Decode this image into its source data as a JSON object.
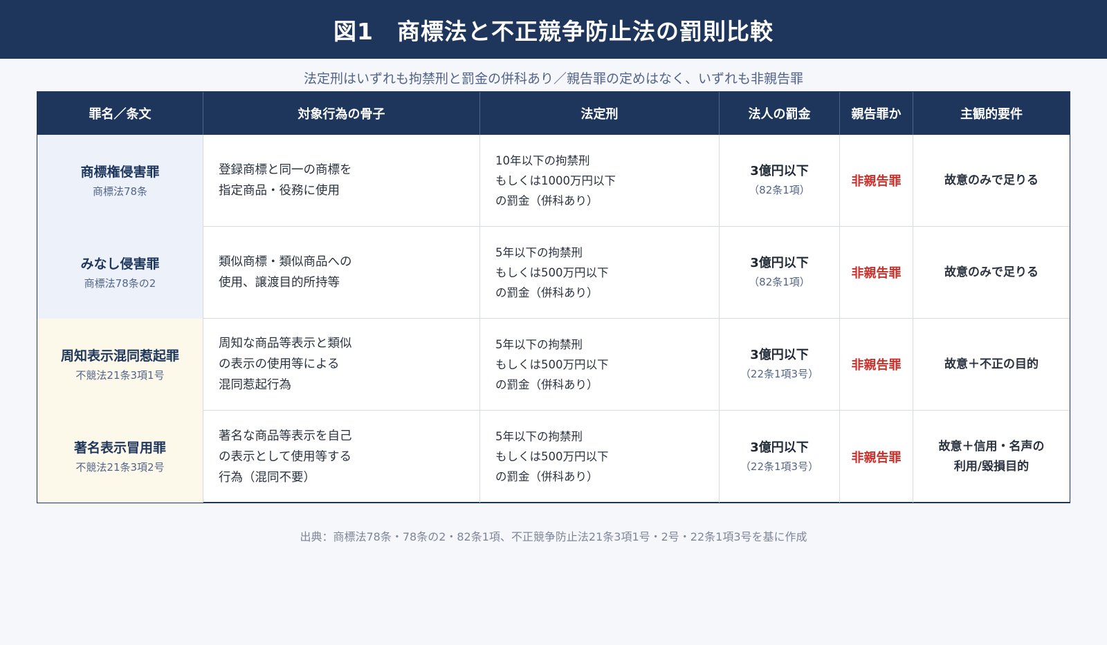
{
  "title": "図1　商標法と不正競争防止法の罰則比較",
  "subtitle": "法定刑はいずれも拘禁刑と罰金の併科あり／親告罪の定めはなく、いずれも非親告罪",
  "headers": [
    "罪名／条文",
    "対象行為の骨子",
    "法定刑",
    "法人の罰金",
    "親告罪か",
    "主観的要件"
  ],
  "rows": [
    {
      "name": "商標権侵害罪",
      "article": "商標法78条",
      "act": [
        "登録商標と同一の商標を",
        "指定商品・役務に使用"
      ],
      "penalty": [
        "10年以下の拘禁刑",
        "もしくは1000万円以下",
        "の罰金（併科あり）"
      ],
      "corp_fine": "3億円以下",
      "corp_ref": "（82条1項）",
      "complaint": "非親告罪",
      "intent": [
        "故意のみで足りる"
      ]
    },
    {
      "name": "みなし侵害罪",
      "article": "商標法78条の2",
      "act": [
        "類似商標・類似商品への",
        "使用、譲渡目的所持等"
      ],
      "penalty": [
        "5年以下の拘禁刑",
        "もしくは500万円以下",
        "の罰金（併科あり）"
      ],
      "corp_fine": "3億円以下",
      "corp_ref": "（82条1項）",
      "complaint": "非親告罪",
      "intent": [
        "故意のみで足りる"
      ]
    },
    {
      "name": "周知表示混同惹起罪",
      "article": "不競法21条3項1号",
      "act": [
        "周知な商品等表示と類似",
        "の表示の使用等による",
        "混同惹起行為"
      ],
      "penalty": [
        "5年以下の拘禁刑",
        "もしくは500万円以下",
        "の罰金（併科あり）"
      ],
      "corp_fine": "3億円以下",
      "corp_ref": "（22条1項3号）",
      "complaint": "非親告罪",
      "intent": [
        "故意＋不正の目的"
      ]
    },
    {
      "name": "著名表示冒用罪",
      "article": "不競法21条3項2号",
      "act": [
        "著名な商品等表示を自己",
        "の表示として使用等する",
        "行為（混同不要）"
      ],
      "penalty": [
        "5年以下の拘禁刑",
        "もしくは500万円以下",
        "の罰金（併科あり）"
      ],
      "corp_fine": "3億円以下",
      "corp_ref": "（22条1項3号）",
      "complaint": "非親告罪",
      "intent": [
        "故意＋信用・名声の",
        "利用/毀損目的"
      ]
    }
  ],
  "source": "出典：商標法78条・78条の2・82条1項、不正競争防止法21条3項1号・2号・22条1項3号を基に作成",
  "colors": {
    "header_bg": "#1e365c",
    "trademark_row_bg": "#edf2fa",
    "unfair_comp_row_bg": "#fcf8ea",
    "non_complaint_red": "#c8312b"
  }
}
